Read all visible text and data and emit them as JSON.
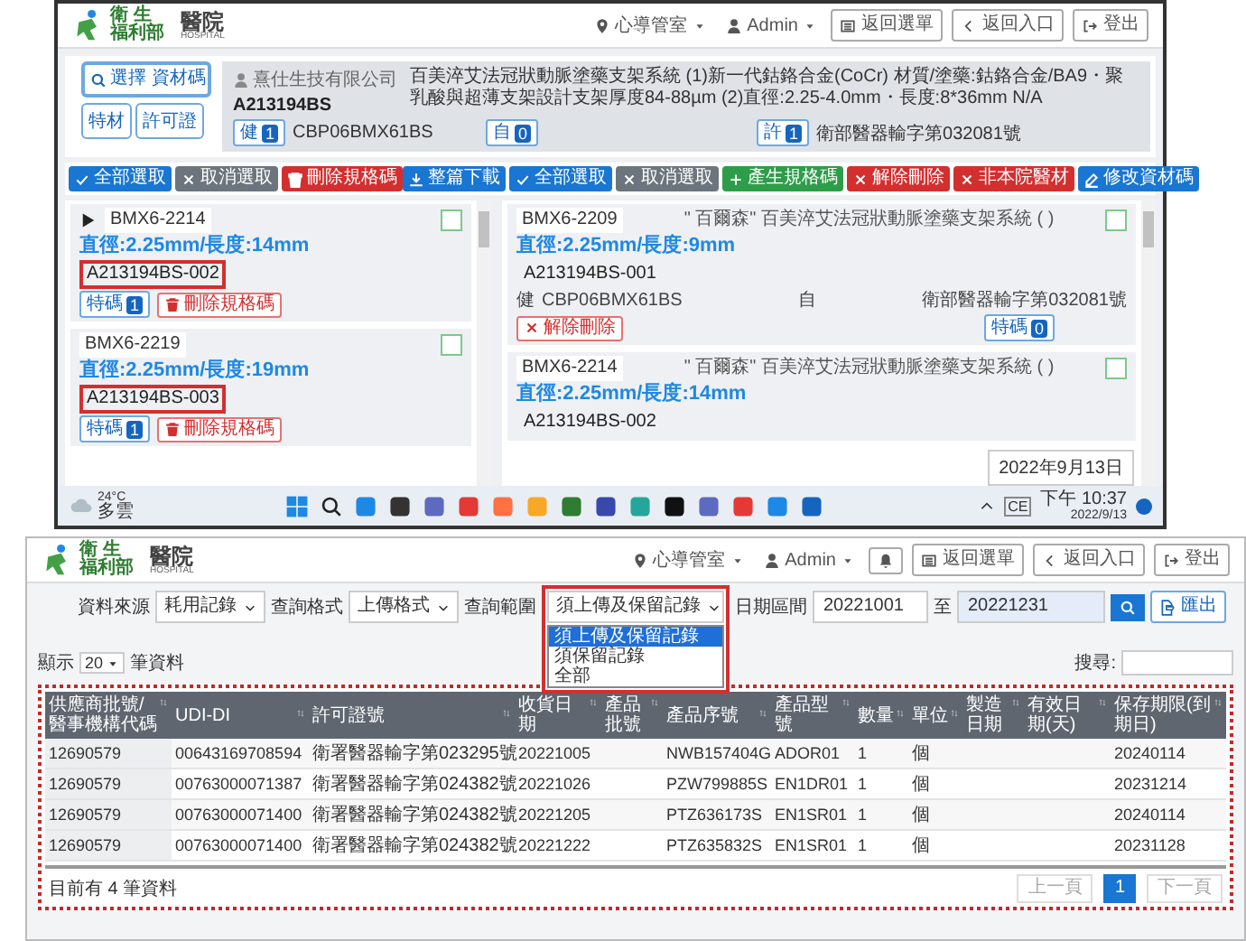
{
  "top_window": {
    "header": {
      "logo_title": "衛 生",
      "logo_subtitle": "福利部",
      "hospital_name": "醫院",
      "hospital_name_en": "HOSPITAL",
      "location": "心導管室",
      "user": "Admin",
      "buttons": [
        {
          "label": "返回選單",
          "kind": "menu"
        },
        {
          "label": "返回入口",
          "kind": "back"
        },
        {
          "label": "登出",
          "kind": "logout"
        }
      ]
    },
    "search_button": "選擇 資材碼",
    "mode_buttons": [
      "特材",
      "許可證"
    ],
    "product": {
      "vendor": "熹仕生技有限公司",
      "code": "A213194BS",
      "description": "百美淬艾法冠狀動脈塗藥支架系統 (1)新一代鈷鉻合金(CoCr) 材質/塗藥:鈷鉻合金/BA9・聚乳酸與超薄支架設計支架厚度84-88µm (2)直徑:2.25-4.0mm・長度:8*36mm N/A",
      "badges": [
        {
          "label": "健",
          "count": "1",
          "text": "CBP06BMX61BS"
        },
        {
          "label": "自",
          "count": "0"
        },
        {
          "label": "許",
          "count": "1",
          "text": "衛部醫器輸字第032081號"
        }
      ]
    },
    "toolbar_left": [
      {
        "label": "全部選取",
        "kind": "select"
      },
      {
        "label": "取消選取",
        "kind": "deselect"
      },
      {
        "label": "刪除規格碼",
        "kind": "delete"
      }
    ],
    "toolbar_right": [
      {
        "label": "整篇下載",
        "kind": "download"
      },
      {
        "label": "全部選取",
        "kind": "select"
      },
      {
        "label": "取消選取",
        "kind": "deselect"
      },
      {
        "label": "產生規格碼",
        "kind": "add"
      },
      {
        "label": "解除刪除",
        "kind": "remove"
      },
      {
        "label": "非本院醫材",
        "kind": "remove"
      },
      {
        "label": "修改資材碼",
        "kind": "edit"
      }
    ],
    "spec_cards": [
      {
        "model": "BMX6-2214",
        "current": true,
        "checked": false,
        "size": "直徑:2.25mm/長度:14mm",
        "code": "A213194BS-002",
        "highlighted": true,
        "tag": "特碼",
        "count": "1",
        "delete": "刪除規格碼"
      },
      {
        "model": "BMX6-2219",
        "current": false,
        "checked": false,
        "size": "直徑:2.25mm/長度:19mm",
        "code": "A213194BS-003",
        "highlighted": true,
        "tag": "特碼",
        "count": "1",
        "delete": "刪除規格碼"
      }
    ],
    "item_cards": [
      {
        "model": "BMX6-2209",
        "brand": "\" 百爾森\" 百美淬艾法冠狀動脈塗藥支架系統 ( )",
        "checked": false,
        "size": "直徑:2.25mm/長度:9mm",
        "code": "A213194BS-001",
        "health_label": "健",
        "health_code": "CBP06BMX61BS",
        "self_label": "自",
        "permit": "衛部醫器輸字第032081號",
        "restore": "解除刪除",
        "tag": "特碼",
        "count": "0"
      },
      {
        "model": "BMX6-2214",
        "brand": "\" 百爾森\" 百美淬艾法冠狀動脈塗藥支架系統 ( )",
        "checked": false,
        "size": "直徑:2.25mm/長度:14mm",
        "code": "A213194BS-002"
      }
    ],
    "taskbar": {
      "temperature": "24°C",
      "weather": "多雲",
      "ime": "CE",
      "time": "下午 10:37",
      "date": "2022/9/13",
      "date_tooltip": "2022年9月13日"
    }
  },
  "bottom_window": {
    "header": {
      "logo_title": "衛 生",
      "logo_subtitle": "福利部",
      "hospital_name": "醫院",
      "hospital_name_en": "HOSPITAL",
      "location": "心導管室",
      "user": "Admin",
      "buttons": [
        {
          "label": "返回選單",
          "kind": "menu"
        },
        {
          "label": "返回入口",
          "kind": "back"
        },
        {
          "label": "登出",
          "kind": "logout"
        }
      ]
    },
    "filters": [
      {
        "label": "資料來源",
        "value": "耗用記錄"
      },
      {
        "label": "查詢格式",
        "value": "上傳格式"
      }
    ],
    "range": {
      "label": "查詢範圍",
      "value": "須上傳及保留記錄",
      "options": [
        {
          "label": "須上傳及保留記錄",
          "selected": true
        },
        {
          "label": "須保留記錄",
          "selected": false
        },
        {
          "label": "全部",
          "selected": false
        }
      ]
    },
    "date_label": "日期區間",
    "date_from": "20221001",
    "date_to_label": "至",
    "date_to": "20221231",
    "export_button": "匯出",
    "show_label": "顯示",
    "page_size": "20",
    "show_unit": "筆資料",
    "search_label": "搜尋:",
    "table": {
      "columns": [
        "供應商批號/醫事機構代碼",
        "UDI-DI",
        "許可證號",
        "收貨日期",
        "產品批號",
        "產品序號",
        "產品型號",
        "數量",
        "單位",
        "製造日期",
        "有效日期(天)",
        "保存期限(到期日)"
      ],
      "rows": [
        [
          "12690579",
          "00643169708594",
          "衛署醫器輸字第023295號",
          "20221005",
          "",
          "NWB157404G",
          "ADOR01",
          "1",
          "個",
          "",
          "",
          "20240114"
        ],
        [
          "12690579",
          "00763000071387",
          "衛署醫器輸字第024382號",
          "20221026",
          "",
          "PZW799885S",
          "EN1DR01",
          "1",
          "個",
          "",
          "",
          "20231214"
        ],
        [
          "12690579",
          "00763000071400",
          "衛署醫器輸字第024382號",
          "20221205",
          "",
          "PTZ636173S",
          "EN1SR01",
          "1",
          "個",
          "",
          "",
          "20240114"
        ],
        [
          "12690579",
          "00763000071400",
          "衛署醫器輸字第024382號",
          "20221222",
          "",
          "PTZ635832S",
          "EN1SR01",
          "1",
          "個",
          "",
          "",
          "20231128"
        ]
      ]
    },
    "footer": "目前有 4 筆資料",
    "pager": {
      "previous": "上一頁",
      "page": "1",
      "next": "下一頁"
    }
  }
}
